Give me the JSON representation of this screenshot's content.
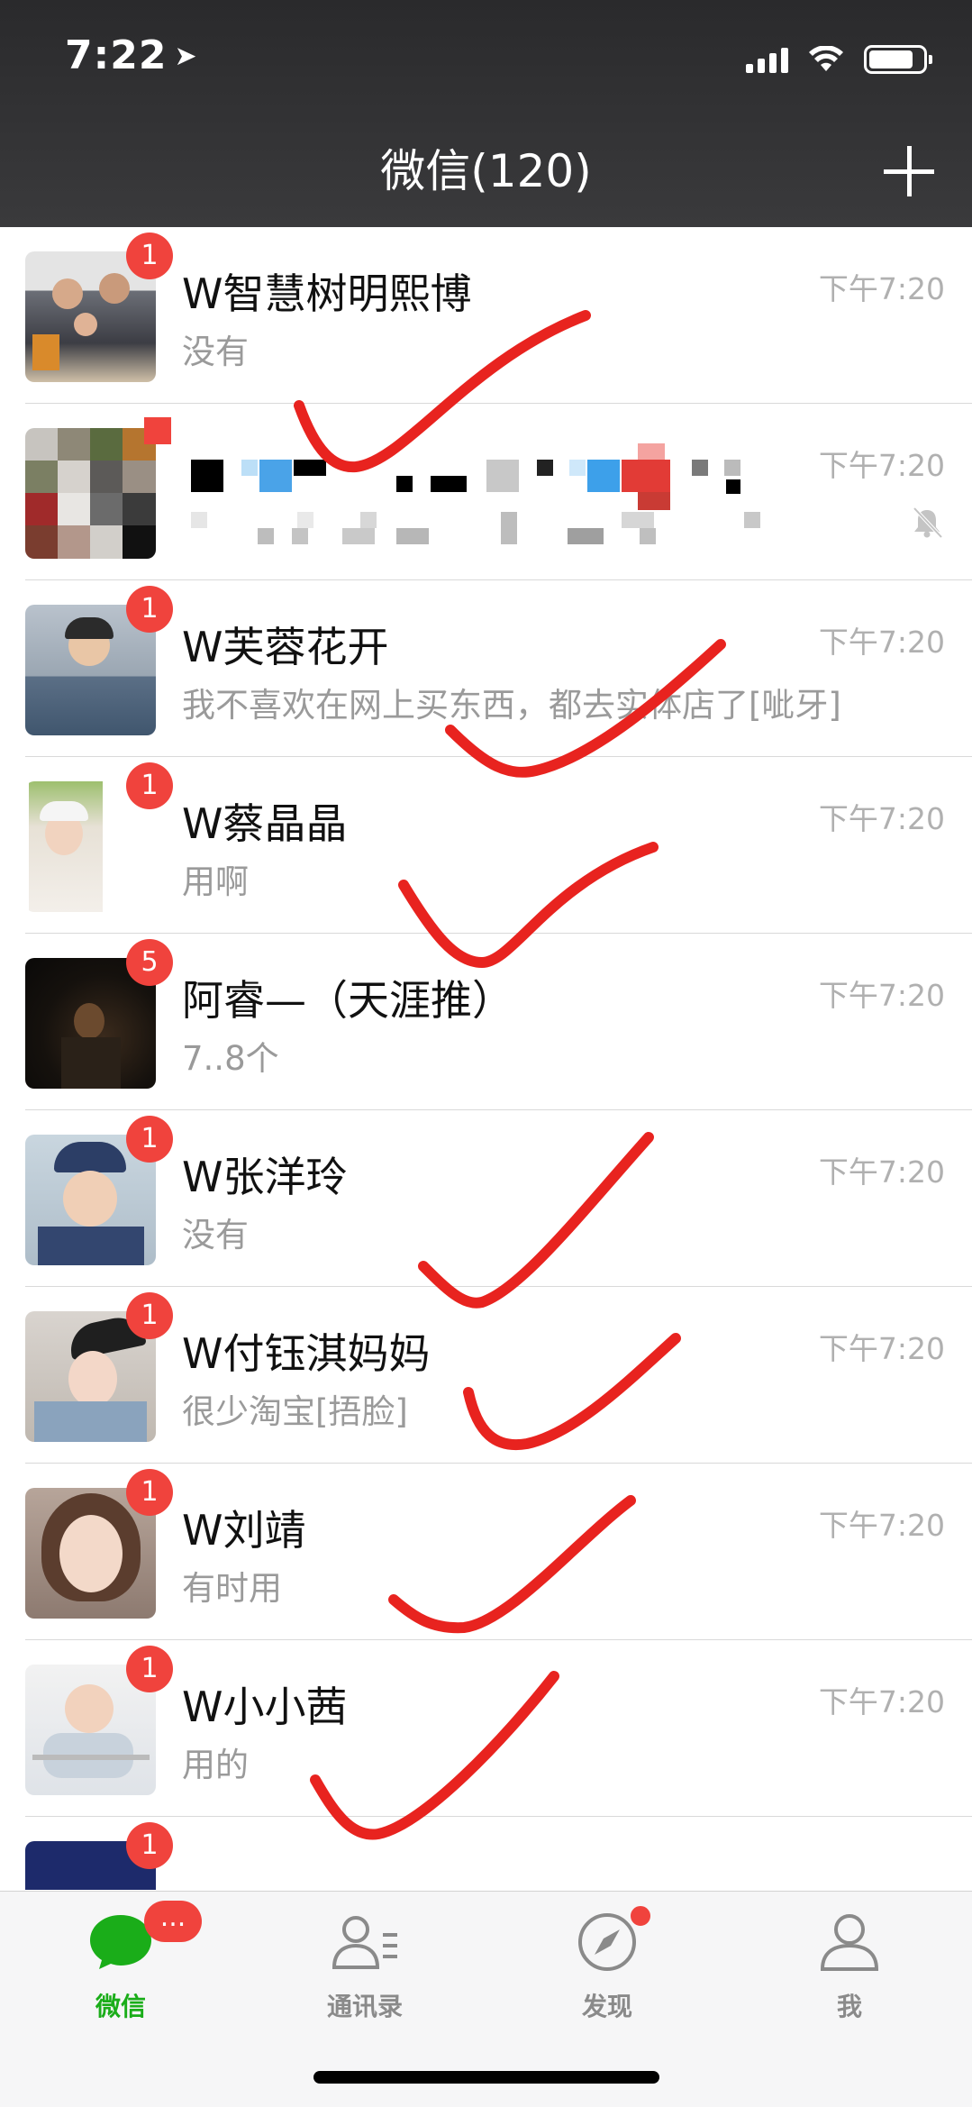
{
  "status_bar": {
    "time": "7:22"
  },
  "header": {
    "title": "微信(120)"
  },
  "chats": [
    {
      "name": "W智慧树明熙博",
      "preview": "没有",
      "time": "下午7:20",
      "badge": "1"
    },
    {
      "name": "",
      "preview": "",
      "time": "下午7:20",
      "badge": "",
      "muted": true
    },
    {
      "name": "W芙蓉花开",
      "preview": "我不喜欢在网上买东西，都去实体店了[呲牙]",
      "time": "下午7:20",
      "badge": "1"
    },
    {
      "name": "W蔡晶晶",
      "preview": "用啊",
      "time": "下午7:20",
      "badge": "1"
    },
    {
      "name": "阿睿—（天涯推）",
      "preview": "7..8个",
      "time": "下午7:20",
      "badge": "5"
    },
    {
      "name": "W张洋玲",
      "preview": "没有",
      "time": "下午7:20",
      "badge": "1"
    },
    {
      "name": "W付钰淇妈妈",
      "preview": "很少淘宝[捂脸]",
      "time": "下午7:20",
      "badge": "1"
    },
    {
      "name": "W刘靖",
      "preview": "有时用",
      "time": "下午7:20",
      "badge": "1"
    },
    {
      "name": "W小小茜",
      "preview": "用的",
      "time": "下午7:20",
      "badge": "1"
    },
    {
      "name": "",
      "preview": "",
      "time": "",
      "badge": "1"
    }
  ],
  "tabbar": {
    "tabs": [
      {
        "label": "微信",
        "badge": "...",
        "active": true
      },
      {
        "label": "通讯录"
      },
      {
        "label": "发现",
        "dot": true
      },
      {
        "label": "我"
      }
    ]
  },
  "colors": {
    "accent": "#1aad19",
    "badge": "#f0433d",
    "header": "#343436",
    "annotation": "#e8231f"
  }
}
